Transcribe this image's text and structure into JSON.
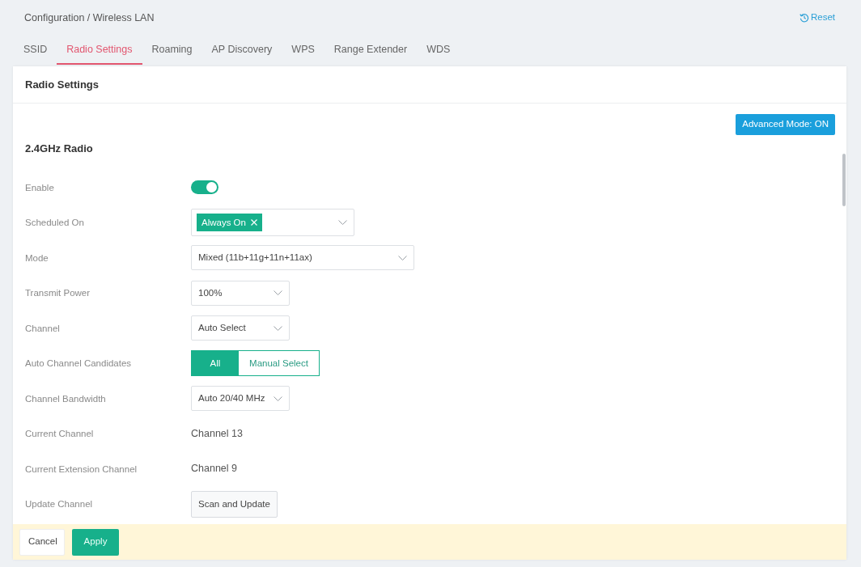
{
  "header": {
    "breadcrumb": "Configuration / Wireless LAN",
    "reset": "Reset"
  },
  "tabs": [
    {
      "label": "SSID",
      "selected": false
    },
    {
      "label": "Radio Settings",
      "selected": true
    },
    {
      "label": "Roaming",
      "selected": false
    },
    {
      "label": "AP Discovery",
      "selected": false
    },
    {
      "label": "WPS",
      "selected": false
    },
    {
      "label": "Range Extender",
      "selected": false
    },
    {
      "label": "WDS",
      "selected": false
    }
  ],
  "panel": {
    "title": "Radio Settings",
    "mode_button": "Advanced Mode: ON",
    "section": "2.4GHz Radio",
    "rows": [
      {
        "kind": "toggle",
        "label": "Enable",
        "on": true
      },
      {
        "kind": "tags",
        "label": "Scheduled On",
        "tags": [
          "Always On"
        ]
      },
      {
        "kind": "select",
        "label": "Mode",
        "value": "Mixed (11b+11g+11n+11ax)"
      },
      {
        "kind": "select",
        "label": "Transmit Power",
        "value": "100%"
      },
      {
        "kind": "select",
        "label": "Channel",
        "value": "Auto Select"
      },
      {
        "kind": "segmented",
        "label": "Auto Channel Candidates",
        "options": [
          {
            "label": "All",
            "selected": true
          },
          {
            "label": "Manual Select",
            "selected": false
          }
        ]
      },
      {
        "kind": "select",
        "label": "Channel Bandwidth",
        "value": "Auto 20/40 MHz"
      },
      {
        "kind": "text",
        "label": "Current Channel",
        "value": "Channel 13"
      },
      {
        "kind": "text",
        "label": "Current Extension Channel",
        "value": "Channel 9"
      },
      {
        "kind": "button",
        "label": "Update Channel",
        "value": "Scan and Update"
      }
    ]
  },
  "footer": {
    "buttons": [
      {
        "label": "Cancel",
        "kind": "secondary"
      },
      {
        "label": "Apply",
        "kind": "primary"
      }
    ]
  }
}
